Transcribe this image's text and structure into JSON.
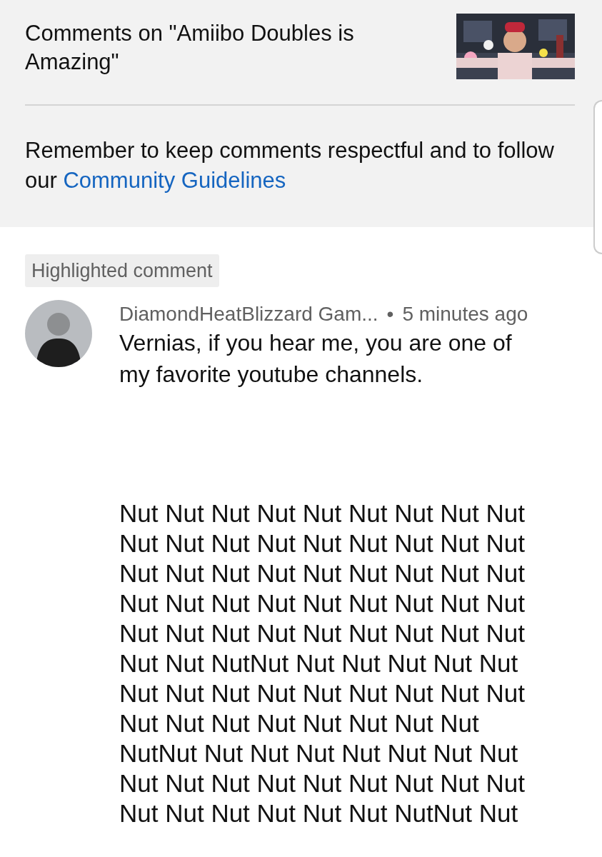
{
  "header": {
    "title": "Comments on \"Amiibo Doubles is Amazing\""
  },
  "notice": {
    "text": "Remember to keep comments respectful and to follow our",
    "link": "Community Guidelines"
  },
  "highlight_label": "Highlighted comment",
  "comment": {
    "author": "DiamondHeatBlizzard Gam...",
    "separator": "•",
    "time": "5 minutes ago",
    "paragraphs": [
      {
        "lines": [
          "Vernias, if you hear me, you are one of",
          "my favorite youtube channels."
        ]
      },
      {
        "lines": [
          "Nut Nut Nut Nut Nut Nut Nut Nut Nut",
          "Nut Nut Nut Nut Nut Nut Nut Nut Nut",
          "Nut Nut Nut Nut Nut Nut Nut Nut Nut",
          "Nut Nut Nut Nut Nut Nut Nut Nut Nut",
          "Nut Nut Nut Nut Nut Nut Nut Nut Nut",
          "Nut Nut NutNut Nut Nut Nut Nut Nut",
          "Nut Nut Nut Nut Nut Nut Nut Nut Nut",
          "Nut Nut Nut Nut Nut Nut Nut Nut",
          "NutNut Nut Nut Nut Nut Nut Nut Nut",
          "Nut Nut Nut Nut Nut Nut Nut Nut Nut",
          "Nut Nut Nut Nut Nut Nut NutNut Nut"
        ]
      }
    ]
  }
}
